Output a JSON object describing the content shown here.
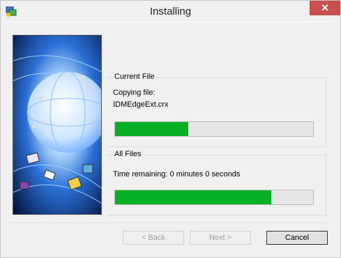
{
  "window": {
    "title": "Installing",
    "close_glyph": "✕"
  },
  "current_file": {
    "group_label": "Current File",
    "action": "Copying file:",
    "filename": "IDMEdgeExt.crx",
    "progress": 0.37
  },
  "all_files": {
    "group_label": "All Files",
    "time_remaining": "Time remaining: 0 minutes 0 seconds",
    "progress": 0.79
  },
  "buttons": {
    "back": "< Back",
    "next": "Next >",
    "cancel": "Cancel"
  },
  "colors": {
    "progress_fill": "#06b025",
    "close_button": "#c7504c"
  },
  "icons": [
    "installer-app-icon",
    "close-icon"
  ]
}
